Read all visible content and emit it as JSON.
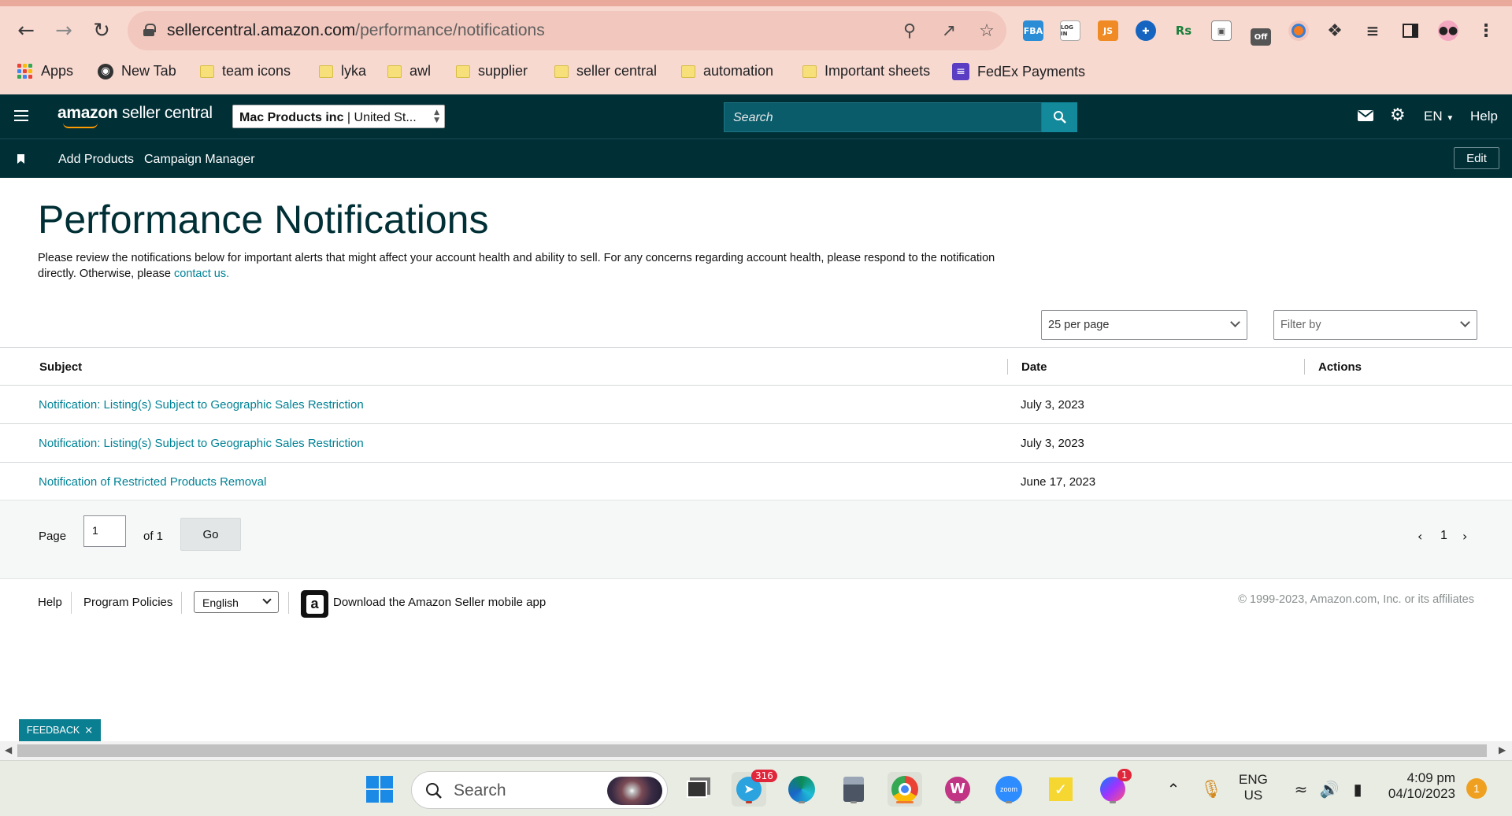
{
  "browser": {
    "url_host": "sellercentral.amazon.com",
    "url_path": "/performance/notifications",
    "bookmarks": [
      {
        "label": "Apps",
        "icon": "apps-grid-icon"
      },
      {
        "label": "New Tab",
        "icon": "globe-icon"
      },
      {
        "label": "team icons",
        "icon": "folder-icon"
      },
      {
        "label": "lyka",
        "icon": "folder-icon"
      },
      {
        "label": "awl",
        "icon": "folder-icon"
      },
      {
        "label": "supplier",
        "icon": "folder-icon"
      },
      {
        "label": "seller central",
        "icon": "folder-icon"
      },
      {
        "label": "automation",
        "icon": "folder-icon"
      },
      {
        "label": "Important sheets",
        "icon": "folder-icon"
      },
      {
        "label": "FedEx Payments",
        "icon": "list-icon"
      }
    ],
    "extensions": {
      "fba": "FBA",
      "login": "LOG IN",
      "js": "JS",
      "rs": "Rs",
      "off": "Off"
    }
  },
  "header": {
    "logo_amazon": "amazon",
    "logo_rest": " seller central",
    "store_name": "Mac Products inc",
    "store_region": " | United St...",
    "search_placeholder": "Search",
    "language": "EN",
    "help": "Help"
  },
  "subnav": {
    "items": [
      "Add Products",
      "Campaign Manager"
    ],
    "edit": "Edit"
  },
  "page": {
    "title": "Performance Notifications",
    "intro": "Please review the notifications below for important alerts that might affect your account health and ability to sell. For any concerns regarding account health, please respond to the notification directly. Otherwise, please ",
    "intro_link": "contact us.",
    "per_page": "25 per page",
    "filter_placeholder": "Filter by"
  },
  "table": {
    "headers": {
      "subject": "Subject",
      "date": "Date",
      "actions": "Actions"
    },
    "rows": [
      {
        "subject": "Notification: Listing(s) Subject to Geographic Sales Restriction",
        "date": "July 3, 2023"
      },
      {
        "subject": "Notification: Listing(s) Subject to Geographic Sales Restriction",
        "date": "July 3, 2023"
      },
      {
        "subject": "Notification of Restricted Products Removal",
        "date": "June 17, 2023"
      }
    ]
  },
  "pagination": {
    "page_label": "Page",
    "current": "1",
    "of_label": "of 1",
    "go": "Go",
    "page_number": "1"
  },
  "footer": {
    "help": "Help",
    "policies": "Program Policies",
    "language": "English",
    "app_text": "Download the Amazon Seller mobile app",
    "copyright": "© 1999-2023, Amazon.com, Inc. or its affiliates"
  },
  "feedback": "FEEDBACK",
  "taskbar": {
    "search": "Search",
    "telegram_badge": "316",
    "messenger_badge": "1",
    "lang_top": "ENG",
    "lang_bottom": "US",
    "time": "4:09 pm",
    "date": "04/10/2023",
    "notif_count": "1"
  },
  "colors": {
    "header_bg": "#002f36",
    "link": "#008296",
    "chrome_bg": "#f8d9d0"
  }
}
